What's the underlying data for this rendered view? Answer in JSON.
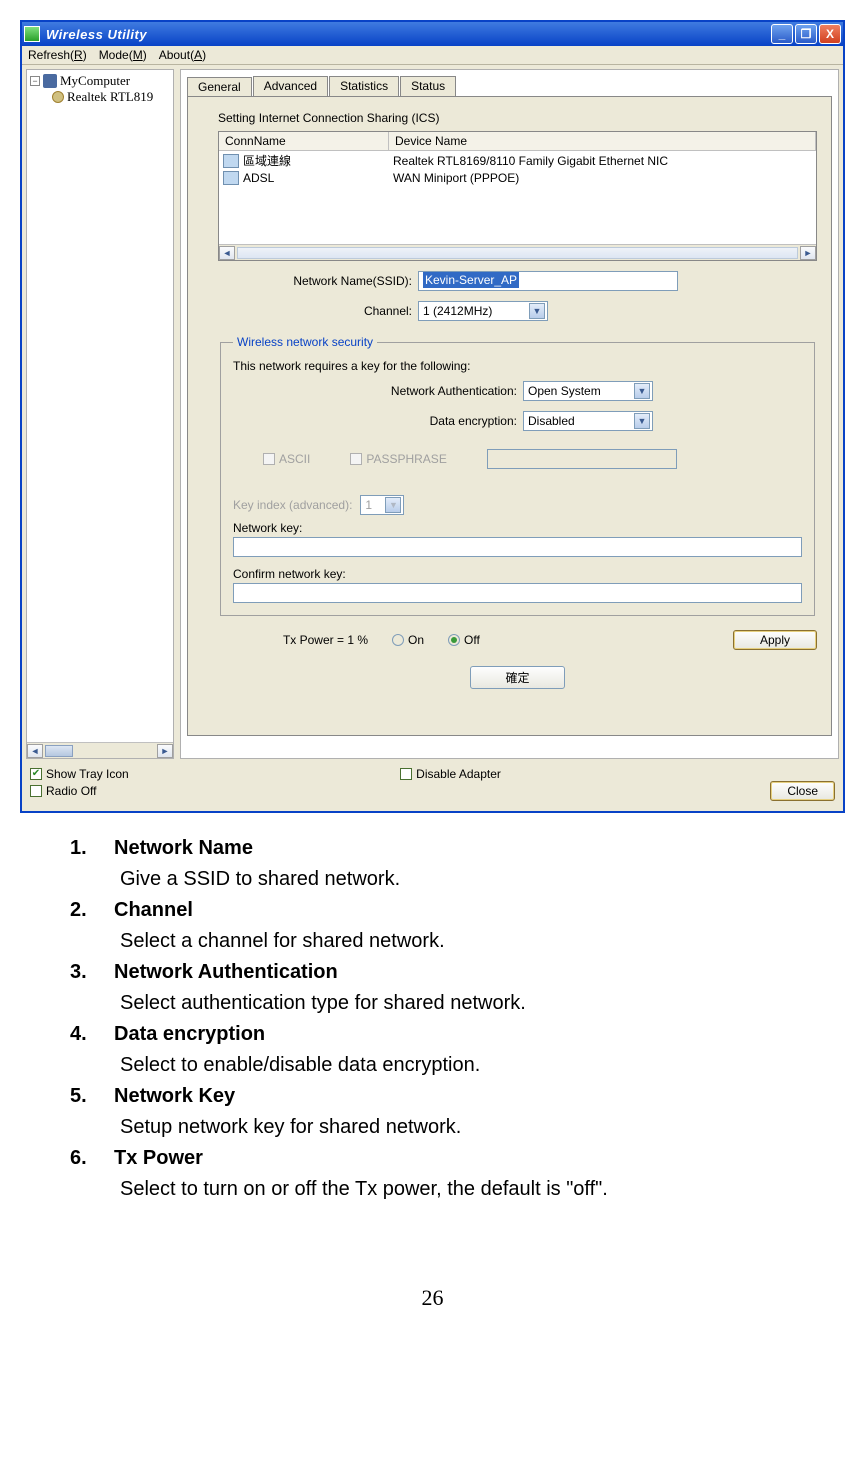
{
  "window": {
    "title": "Wireless Utility",
    "min": "_",
    "max": "❐",
    "close": "X"
  },
  "menubar": {
    "refresh": "Refresh(R)",
    "refresh_u": "R",
    "mode": "Mode(M)",
    "mode_u": "M",
    "about": "About(A)",
    "about_u": "A"
  },
  "sidebar": {
    "root": "MyComputer",
    "child": "Realtek RTL819"
  },
  "tabs": {
    "general": "General",
    "advanced": "Advanced",
    "statistics": "Statistics",
    "status": "Status"
  },
  "ics": {
    "section_label": "Setting Internet Connection Sharing (ICS)",
    "col1": "ConnName",
    "col2": "Device Name",
    "rows": [
      {
        "conn": "區域連線",
        "dev": "Realtek RTL8169/8110 Family Gigabit Ethernet NIC"
      },
      {
        "conn": "ADSL",
        "dev": "WAN Miniport (PPPOE)"
      }
    ]
  },
  "form": {
    "ssid_label": "Network Name(SSID):",
    "ssid_value": "Kevin-Server_AP",
    "channel_label": "Channel:",
    "channel_value": "1  (2412MHz)"
  },
  "security": {
    "legend": "Wireless network security",
    "intro": "This network requires a key for the following:",
    "auth_label": "Network Authentication:",
    "auth_value": "Open System",
    "enc_label": "Data encryption:",
    "enc_value": "Disabled",
    "ascii": "ASCII",
    "passphrase": "PASSPHRASE",
    "keyidx_label": "Key index (advanced):",
    "keyidx_value": "1",
    "netkey_label": "Network key:",
    "confirm_label": "Confirm network key:"
  },
  "tx": {
    "label": "Tx Power =  1 %",
    "on": "On",
    "off": "Off",
    "apply": "Apply"
  },
  "ok_btn": "確定",
  "bottom": {
    "show_tray": "Show Tray Icon",
    "radio_off": "Radio Off",
    "disable_adapter": "Disable Adapter",
    "close": "Close"
  },
  "doc": {
    "items": [
      {
        "n": "1.",
        "title": "Network Name",
        "desc": "Give a SSID to shared network."
      },
      {
        "n": "2.",
        "title": "Channel",
        "desc": "Select a channel for shared network."
      },
      {
        "n": "3.",
        "title": "Network Authentication",
        "desc": "Select authentication type for shared network."
      },
      {
        "n": "4.",
        "title": "Data encryption",
        "desc": "Select to enable/disable data encryption."
      },
      {
        "n": "5.",
        "title": "Network Key",
        "desc": "Setup network key for shared network."
      },
      {
        "n": "6.",
        "title": "Tx Power",
        "desc": "Select to turn on or off the Tx power, the default is \"off\"."
      }
    ]
  },
  "page_number": "26"
}
